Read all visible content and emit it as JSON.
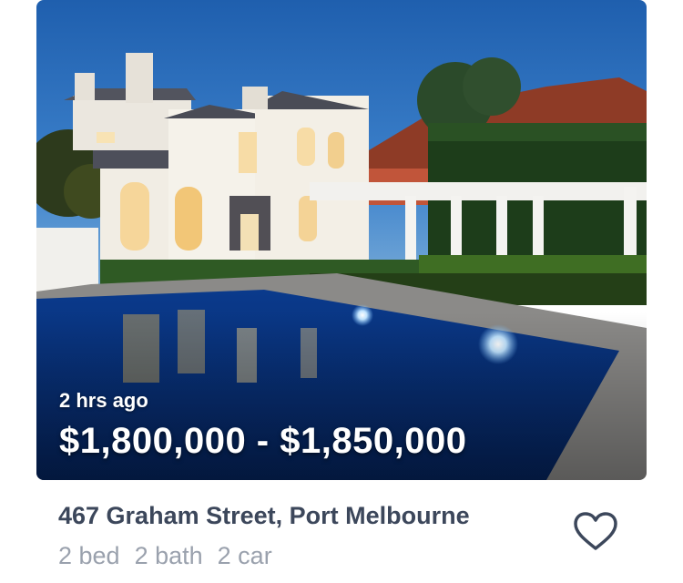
{
  "listing": {
    "posted": "2 hrs ago",
    "price": "$1,800,000 - $1,850,000",
    "address": "467 Graham Street, Port Melbourne",
    "features": {
      "bed": "2 bed",
      "bath": "2 bath",
      "car": "2 car"
    },
    "favorite_icon": "heart-outline-icon"
  },
  "colors": {
    "address_text": "#3c475b",
    "features_text": "#9aa1ad",
    "heart_stroke": "#3c475b"
  }
}
